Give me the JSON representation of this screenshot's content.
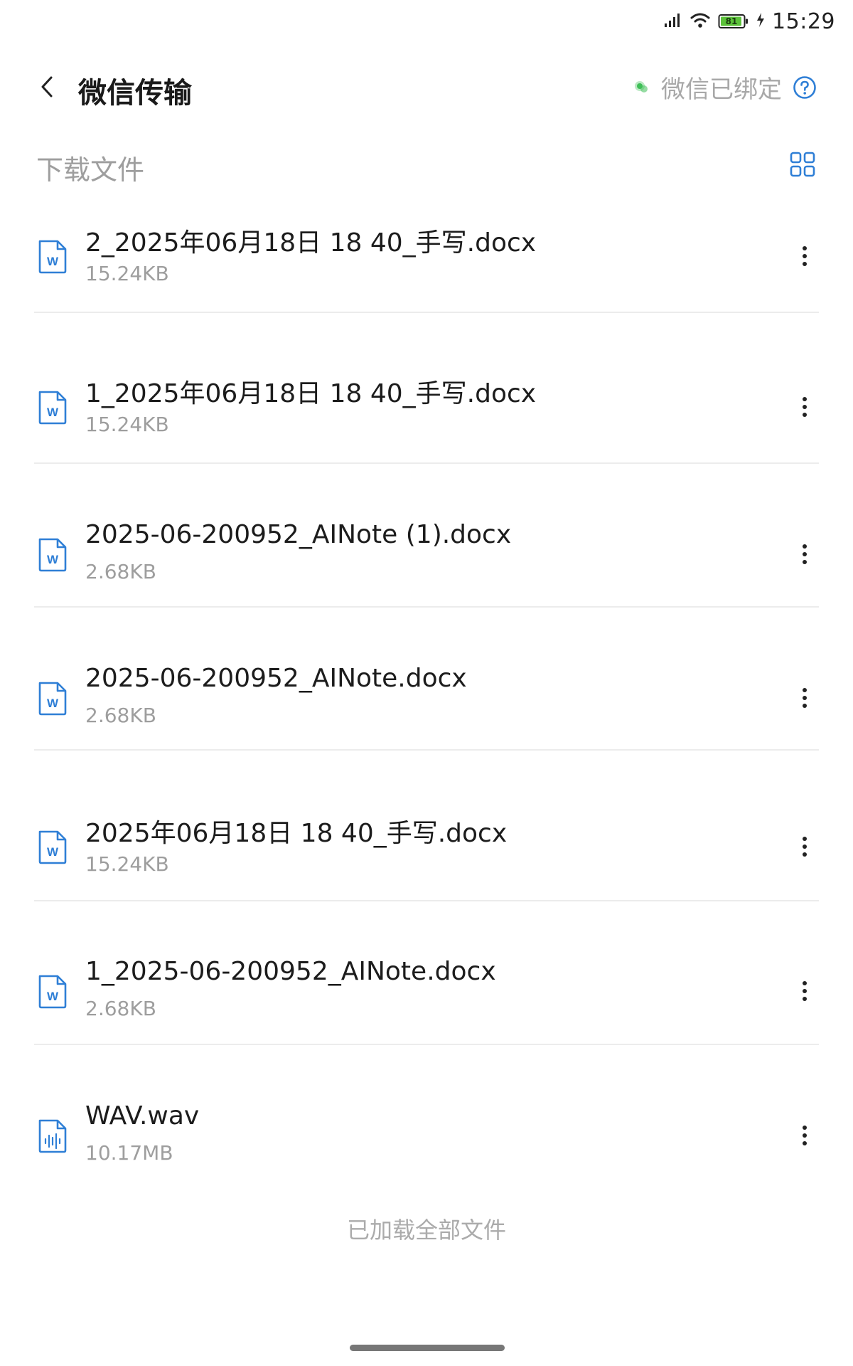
{
  "status_bar": {
    "time": "15:29",
    "battery_level": "81",
    "icons": [
      "signal-icon",
      "wifi-icon",
      "battery-icon",
      "charging-icon"
    ]
  },
  "header": {
    "title": "微信传输",
    "bind_status": "微信已绑定",
    "back_icon": "chevron-left-icon",
    "help_icon": "help-circle-icon"
  },
  "section": {
    "title": "下载文件",
    "view_icon": "grid-view-icon"
  },
  "files": [
    {
      "name": "2_2025年06月18日 18 40_手写.docx",
      "size": "15.24KB",
      "type": "word"
    },
    {
      "name": "1_2025年06月18日 18 40_手写.docx",
      "size": "15.24KB",
      "type": "word"
    },
    {
      "name": "2025-06-200952_AINote (1).docx",
      "size": "2.68KB",
      "type": "word"
    },
    {
      "name": "2025-06-200952_AINote.docx",
      "size": "2.68KB",
      "type": "word"
    },
    {
      "name": "2025年06月18日 18 40_手写.docx",
      "size": "15.24KB",
      "type": "word"
    },
    {
      "name": "1_2025-06-200952_AINote.docx",
      "size": "2.68KB",
      "type": "word"
    },
    {
      "name": "WAV.wav",
      "size": "10.17MB",
      "type": "audio"
    }
  ],
  "footer": {
    "end_note": "已加载全部文件"
  },
  "colors": {
    "accent": "#2f7fd6",
    "wechat_green": "#3fbf57",
    "battery_green": "#5cc23a",
    "text_primary": "#1c1c1c",
    "text_secondary": "#9e9e9e"
  }
}
